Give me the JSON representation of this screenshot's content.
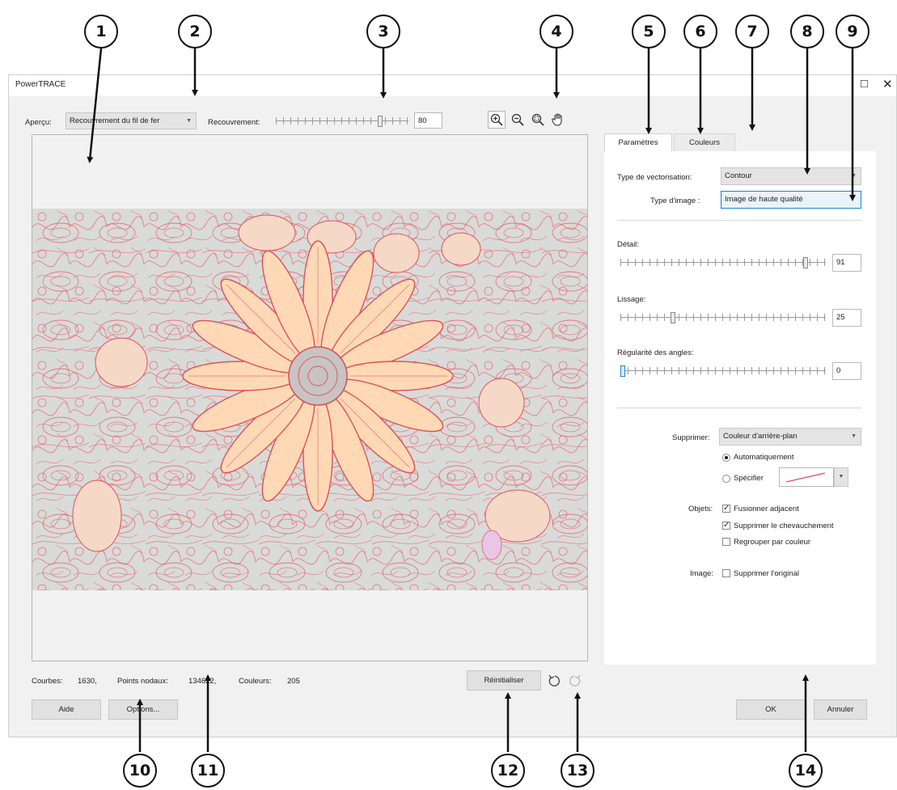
{
  "window": {
    "title": "PowerTRACE",
    "maximize_icon": "□",
    "close_icon": "✕"
  },
  "toolbar": {
    "preview_label": "Aperçu:",
    "preview_value": "Recouvrement du fil de fer",
    "overlay_label": "Recouvrement:",
    "overlay_value": "80"
  },
  "status": {
    "curves_label": "Courbes:",
    "curves_value": "1630,",
    "nodes_label": "Points nodaux:",
    "nodes_value": "134622,",
    "colors_label": "Couleurs:",
    "colors_value": "205"
  },
  "buttons": {
    "help": "Aide",
    "options": "Options...",
    "reset": "Réinitialiser",
    "ok": "OK",
    "cancel": "Annuler"
  },
  "tabs": [
    {
      "label": "Paramètres",
      "active": true
    },
    {
      "label": "Couleurs",
      "active": false
    }
  ],
  "settings": {
    "trace_type_label": "Type de vectorisation:",
    "trace_type_value": "Contour",
    "image_type_label": "Type d'image :",
    "image_type_value": "Image de haute qualité",
    "detail_label": "Détail:",
    "detail_value": "91",
    "smoothing_label": "Lissage:",
    "smoothing_value": "25",
    "corner_label": "Régularité des angles:",
    "corner_value": "0",
    "remove_label": "Supprimer:",
    "remove_value": "Couleur d'arrière-plan",
    "auto_label": "Automatiquement",
    "specify_label": "Spécifier",
    "objects_label": "Objets:",
    "merge_label": "Fusionner adjacent",
    "remove_overlap_label": "Supprimer le chevauchement",
    "group_label": "Regrouper par couleur",
    "image_label": "Image:",
    "delete_original_label": "Supprimer l'original"
  },
  "callouts": [
    "1",
    "2",
    "3",
    "4",
    "5",
    "6",
    "7",
    "8",
    "9",
    "10",
    "11",
    "12",
    "13",
    "14"
  ],
  "colors": {
    "accent": "#1f7fd6",
    "trace_line": "#e8505a",
    "petal": "#ffd9b5"
  }
}
